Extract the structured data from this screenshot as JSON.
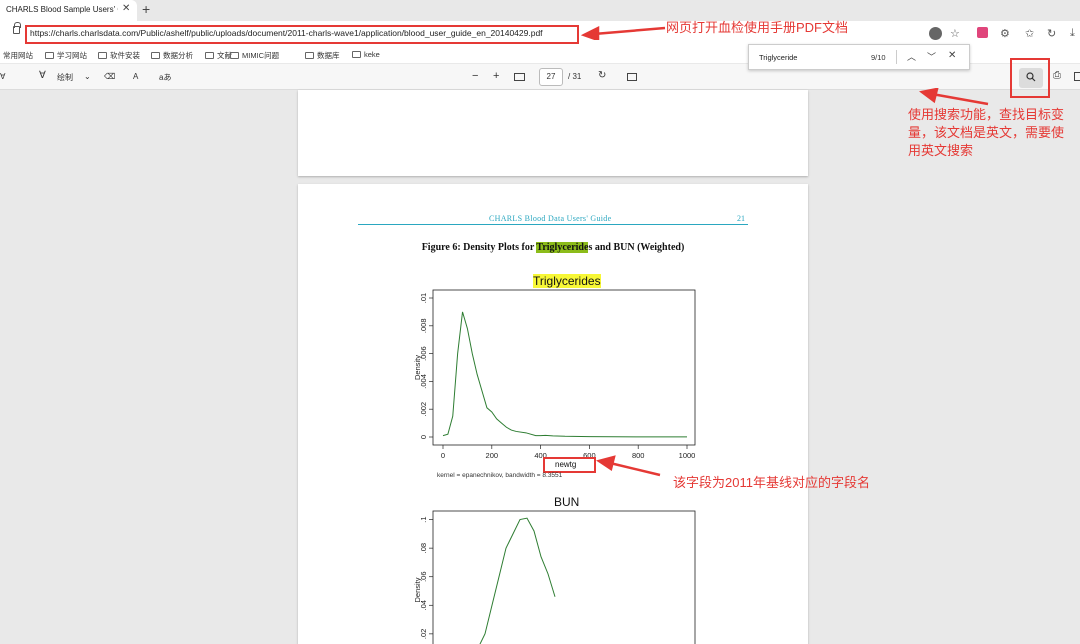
{
  "browser": {
    "tab_title": "CHARLS Blood Sample Users' Gu",
    "tab_close": "✕",
    "new_tab": "+",
    "url": "https://charls.charlsdata.com/Public/ashelf/public/uploads/document/2011-charls-wave1/application/blood_user_guide_en_20140429.pdf",
    "bookmarks": [
      "常用网站",
      "学习网站",
      "软件安装",
      "数据分析",
      "文献",
      "MIMIC问题",
      "数据库",
      "keke"
    ]
  },
  "pdf_toolbar": {
    "draw_label": "绘制",
    "read_aloud": "A",
    "translate": "aあ",
    "zoom_out": "−",
    "zoom_in": "+",
    "page_current": "27",
    "page_total": "/ 31"
  },
  "find": {
    "query": "Triglyceride",
    "count": "9/10"
  },
  "page": {
    "running_head": "CHARLS Blood Data Users' Guide",
    "page_number": "21",
    "figure_title_pre": "Figure 6: Density Plots for ",
    "figure_title_hl": "Triglyceride",
    "figure_title_post": "s and BUN (Weighted)"
  },
  "chart_data": [
    {
      "type": "line",
      "title": "Triglycerides",
      "xlabel": "newtg",
      "ylabel": "Density",
      "x_ticks": [
        "0",
        "200",
        "400",
        "600",
        "800",
        "1000"
      ],
      "y_ticks": [
        "0",
        ".002",
        ".004",
        ".006",
        ".008",
        ".01"
      ],
      "xlim": [
        0,
        1000
      ],
      "ylim": [
        0,
        0.01
      ],
      "note": "kernel = epanechnikov, bandwidth = 8.3551",
      "x": [
        0,
        20,
        40,
        60,
        80,
        100,
        120,
        140,
        160,
        180,
        200,
        220,
        240,
        260,
        280,
        300,
        340,
        380,
        400,
        420,
        450,
        500,
        600,
        700,
        800,
        900,
        1000
      ],
      "y": [
        0.0001,
        0.0002,
        0.0015,
        0.006,
        0.009,
        0.0078,
        0.006,
        0.0045,
        0.0033,
        0.0021,
        0.0018,
        0.0013,
        0.001,
        0.0007,
        0.0005,
        0.0004,
        0.0003,
        0.0001,
        0.0001,
        0.00012,
        8e-05,
        5e-05,
        3e-05,
        2e-05,
        1e-05,
        1e-05,
        1e-05
      ]
    },
    {
      "type": "line",
      "title": "BUN",
      "xlabel": "",
      "ylabel": "Density",
      "y_ticks": [
        ".02",
        ".04",
        ".06",
        ".08",
        ".1"
      ],
      "ylim": [
        0.015,
        0.106
      ],
      "x": [
        0.0,
        0.05,
        0.1,
        0.15,
        0.2,
        0.25,
        0.3,
        0.35,
        0.4,
        0.45,
        0.5,
        0.55
      ],
      "y": [
        0.01,
        0.02,
        0.04,
        0.06,
        0.08,
        0.09,
        0.1,
        0.101,
        0.092,
        0.074,
        0.062,
        0.046
      ]
    }
  ],
  "annotations": {
    "url_note": "网页打开血检使用手册PDF文档",
    "search_note": "使用搜索功能，查找目标变量，该文档是英文，需要使用英文搜索",
    "field_note": "该字段为2011年基线对应的字段名"
  }
}
